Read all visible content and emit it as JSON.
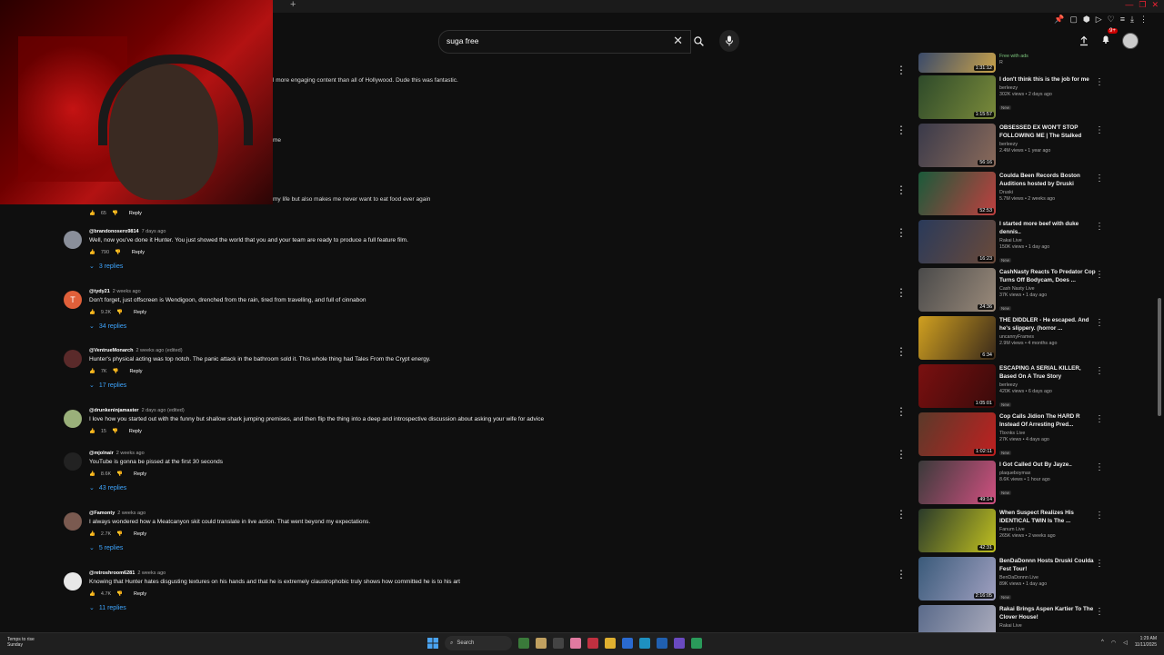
{
  "browser": {
    "new_tab_label": "+"
  },
  "header": {
    "search_query": "suga free",
    "notification_badge": "9+"
  },
  "comment_fragments": {
    "line1": "l more engaging content than all of Hollywood. Dude this was fantastic.",
    "line2": "me",
    "line3": "my life but also makes me never want to eat food ever again",
    "first_likes": "65",
    "reply_label": "Reply"
  },
  "comments": [
    {
      "author": "@brandonosero9814",
      "date": "7 days ago",
      "text": "Well, now you've done it Hunter. You just showed the world that you and your team are ready to produce a full feature film.",
      "likes": "790",
      "replies": "3 replies",
      "avatar_letter": "",
      "avatar_color": "#8a8f9a"
    },
    {
      "author": "@tydy21",
      "date": "2 weeks ago",
      "text": "Don't forget, just offscreen is Wendigoon, drenched from the rain, tired from travelling, and full of cinnabon",
      "likes": "9.2K",
      "replies": "34 replies",
      "avatar_letter": "T",
      "avatar_color": "#e0603a"
    },
    {
      "author": "@VentrueMonarch",
      "date": "2 weeks ago (edited)",
      "text": "Hunter's physical acting was top notch. The panic attack in the bathroom sold it. This whole thing had Tales From the Crypt energy.",
      "likes": "7K",
      "replies": "17 replies",
      "avatar_letter": "",
      "avatar_color": "#5a2a2a"
    },
    {
      "author": "@drunkeninjamaster",
      "date": "2 days ago (edited)",
      "text": "I love how you started out with the funny but shallow shark jumping premises, and then flip the thing into a deep and introspective discussion about asking your wife for advice",
      "likes": "15",
      "replies": "",
      "avatar_letter": "",
      "avatar_color": "#9ab07a"
    },
    {
      "author": "@mjolnair",
      "date": "2 weeks ago",
      "text": "YouTube is gonna be pissed at the first 30 seconds",
      "likes": "8.6K",
      "replies": "43 replies",
      "avatar_letter": "",
      "avatar_color": "#222"
    },
    {
      "author": "@Famonty",
      "date": "2 weeks ago",
      "text": "I always wondered how a Meatcanyon skit could translate in live action. That went beyond my expectations.",
      "likes": "2.7K",
      "replies": "5 replies",
      "avatar_letter": "",
      "avatar_color": "#7a5a50"
    },
    {
      "author": "@retroshroom6281",
      "date": "2 weeks ago",
      "text": "Knowing that Hunter hates disgusting textures on his hands and that he is extremely claustrophobic truly shows how committed he is to his art",
      "likes": "4.7K",
      "replies": "11 replies",
      "avatar_letter": "",
      "avatar_color": "#e8e8e8"
    }
  ],
  "sidebar": [
    {
      "title": "",
      "channel": "",
      "stats": "Free with ads",
      "extra": "R",
      "duration": "1:31:12",
      "new": false,
      "color1": "#3a4a6a",
      "color2": "#c9a24a"
    },
    {
      "title": "I don't think this is the job for me",
      "channel": "berleezy",
      "stats": "302K views • 2 days ago",
      "duration": "1:15:57",
      "new": true,
      "color1": "#2e4a2a",
      "color2": "#7a8a3a"
    },
    {
      "title": "OBSESSED EX WON'T STOP FOLLOWING ME | The Stalked",
      "channel": "berleezy",
      "stats": "2.4M views • 1 year ago",
      "duration": "56:16",
      "new": false,
      "color1": "#3a3a4a",
      "color2": "#8a6a5a"
    },
    {
      "title": "Coulda Been Records Boston Auditions hosted by Druski",
      "channel": "Druski",
      "stats": "5.7M views • 2 weeks ago",
      "duration": "52:53",
      "new": false,
      "color1": "#1a5a3a",
      "color2": "#c04040"
    },
    {
      "title": "I started more beef with duke dennis..",
      "channel": "Rakai Live",
      "stats": "150K views • 1 day ago",
      "duration": "16:23",
      "new": true,
      "color1": "#2a3a5a",
      "color2": "#6a4a3a"
    },
    {
      "title": "CashNasty Reacts To Predator Cop Turns Off Bodycam, Does ...",
      "channel": "Cash Nasty Live",
      "stats": "37K views • 1 day ago",
      "duration": "24:36",
      "new": true,
      "color1": "#4a4a4a",
      "color2": "#9a8a7a"
    },
    {
      "title": "THE DIDDLER - He escaped. And he's slippery. (horror ...",
      "channel": "uncannyFrames",
      "stats": "2.9M views • 4 months ago",
      "duration": "6:34",
      "new": false,
      "color1": "#d0a020",
      "color2": "#3a2a1a"
    },
    {
      "title": "ESCAPING A SERIAL KILLER, Based On A True Story",
      "channel": "berleezy",
      "stats": "420K views • 6 days ago",
      "duration": "1:05:01",
      "new": true,
      "color1": "#7a1010",
      "color2": "#3a0a0a"
    },
    {
      "title": "Cop Calls Jidion The HARD R Instead Of Arresting Pred...",
      "channel": "Tbxnks Live",
      "stats": "27K views • 4 days ago",
      "duration": "1:02:11",
      "new": true,
      "color1": "#5a3a2a",
      "color2": "#c02020"
    },
    {
      "title": "I Got Called Out By Jayze..",
      "channel": "plaqueboymax",
      "stats": "8.6K views • 1 hour ago",
      "duration": "49:14",
      "new": true,
      "color1": "#3a3a3a",
      "color2": "#d05080"
    },
    {
      "title": "When Suspect Realizes His IDENTICAL TWIN Is The ...",
      "channel": "Fanum Live",
      "stats": "265K views • 2 weeks ago",
      "duration": "42:31",
      "new": false,
      "color1": "#2a3a2a",
      "color2": "#c0c020"
    },
    {
      "title": "BenDaDonnn Hosts Druski Coulda Fest Tour!",
      "channel": "BenDaDonnn Live",
      "stats": "89K views • 1 day ago",
      "duration": "2:16:05",
      "new": true,
      "color1": "#3a5a7a",
      "color2": "#a0a0c0"
    },
    {
      "title": "Rakai Brings Aspen Kartier To The Clover House!",
      "channel": "Rakai Live",
      "stats": "",
      "duration": "",
      "new": false,
      "color1": "#5a6a8a",
      "color2": "#b0b0c0"
    }
  ],
  "labels": {
    "new": "New"
  },
  "taskbar": {
    "weather_line1": "Temps to rise",
    "weather_line2": "Sunday",
    "search_label": "Search",
    "time": "1:29 AM",
    "date": "11/11/2025"
  }
}
